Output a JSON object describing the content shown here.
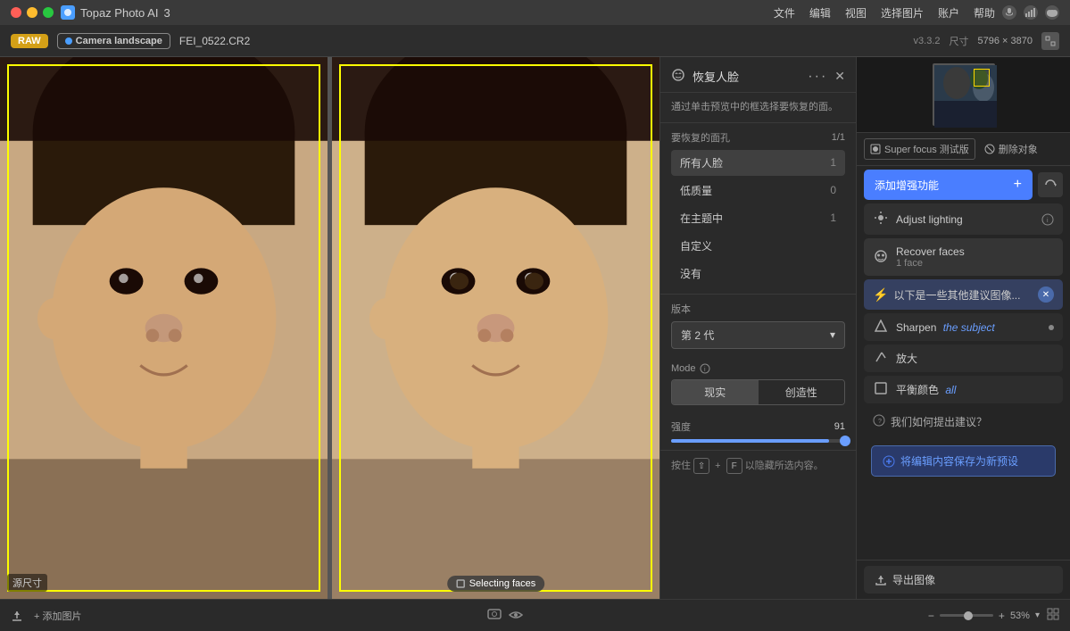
{
  "app": {
    "name": "Topaz Photo AI",
    "version": "v3.3.2",
    "tab_number": "3",
    "file_name": "FEI_0522.CR2",
    "tag_raw": "RAW",
    "tag_camera": "Camera landscape",
    "dimensions": "5796 × 3870"
  },
  "menu": {
    "items": [
      "文件",
      "编辑",
      "视图",
      "选择图片",
      "账户",
      "帮助"
    ]
  },
  "face_panel": {
    "title": "恢复人脸",
    "description": "通过单击预览中的框选择要恢复的面。",
    "faces_label": "要恢复的面孔",
    "faces_count": "1/1",
    "face_list": [
      {
        "label": "所有人脸",
        "count": "1"
      },
      {
        "label": "低质量",
        "count": "0"
      },
      {
        "label": "在主题中",
        "count": "1"
      },
      {
        "label": "自定义",
        "count": ""
      },
      {
        "label": "没有",
        "count": ""
      }
    ],
    "version_label": "版本",
    "version_value": "第 2 代",
    "mode_label": "Mode",
    "mode_options": [
      "现实",
      "创造性"
    ],
    "active_mode": "现实",
    "strength_label": "强度",
    "strength_value": "91",
    "hide_tip": "按住",
    "hide_key1": "⇧",
    "hide_key2": "F",
    "hide_tip2": "以隐藏所选内容。"
  },
  "enhance_panel": {
    "super_focus_label": "Super focus 测试版",
    "remove_object_label": "删除对象",
    "add_enhance_label": "添加增强功能",
    "items": [
      {
        "icon": "☀",
        "label": "Adjust lighting",
        "sub": "",
        "has_info": true
      },
      {
        "icon": "☺",
        "label": "Recover faces",
        "sub": "1 face",
        "has_info": false
      }
    ],
    "suggestions": {
      "title": "以下是一些其他建议图像...",
      "items": [
        {
          "icon": "△",
          "label": "Sharpen",
          "italic_part": "the subject",
          "has_dot": true
        },
        {
          "icon": "↗",
          "label": "放大",
          "has_dot": false
        },
        {
          "icon": "☐",
          "label": "平衡颜色",
          "italic_part": "all",
          "has_dot": false
        }
      ]
    },
    "how_label": "我们如何提出建议？",
    "save_preset_label": "将编辑内容保存为新预设",
    "export_label": "导出图像"
  },
  "bottom_bar": {
    "upload_label": "上传",
    "add_image_label": "+ 添加图片",
    "zoom_value": "53%",
    "zoom_minus": "−",
    "zoom_plus": "+"
  },
  "canvas": {
    "left_label": "源尺寸",
    "right_label": "Selecting faces"
  }
}
